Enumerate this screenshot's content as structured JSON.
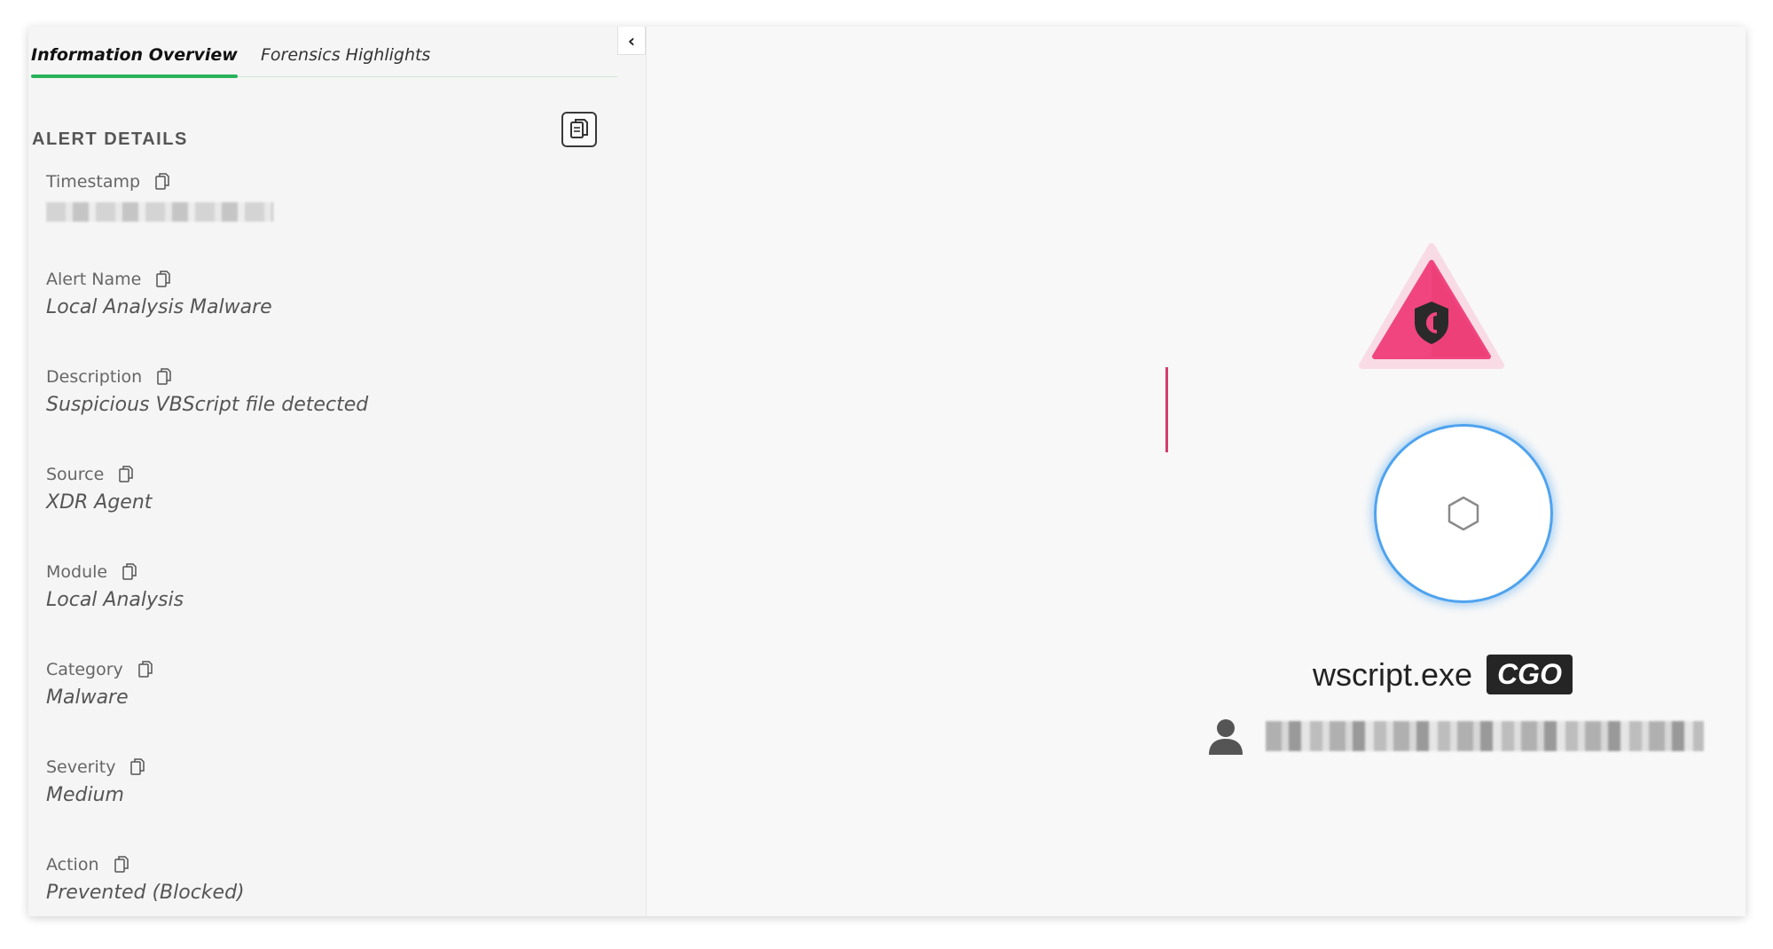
{
  "tabs": [
    {
      "label": "Information Overview",
      "active": true
    },
    {
      "label": "Forensics Highlights",
      "active": false
    }
  ],
  "collapse_icon": "chevron-left-icon",
  "section_title": "ALERT DETAILS",
  "fields": [
    {
      "label": "Timestamp",
      "value": null,
      "redacted": true
    },
    {
      "label": "Alert Name",
      "value": "Local Analysis Malware"
    },
    {
      "label": "Description",
      "value": "Suspicious VBScript file detected"
    },
    {
      "label": "Source",
      "value": "XDR Agent"
    },
    {
      "label": "Module",
      "value": "Local Analysis"
    },
    {
      "label": "Category",
      "value": "Malware"
    },
    {
      "label": "Severity",
      "value": "Medium"
    },
    {
      "label": "Action",
      "value": "Prevented (Blocked)"
    }
  ],
  "graph": {
    "alert_icon": "shield-alert-icon",
    "process_icon": "hexagon-icon",
    "process_name": "wscript.exe",
    "process_badge": "CGO",
    "user_icon": "user-icon",
    "user_redacted": true
  },
  "colors": {
    "tab_accent": "#26b35a",
    "alert_pink": "#f0457f",
    "node_blue": "#4fa3ee",
    "connector": "#d63d6e"
  }
}
